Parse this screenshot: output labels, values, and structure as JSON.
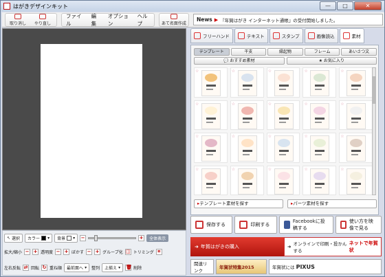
{
  "window": {
    "title": "はがきデザインキット",
    "buttons": [
      "—",
      "□",
      "✕"
    ]
  },
  "toolbar": {
    "undo_label": "取り消し",
    "redo_label": "やり直し",
    "menu": [
      "ファイル",
      "編集",
      "オプション",
      "ヘルプ"
    ],
    "address_label": "あて名面作成"
  },
  "news": {
    "label": "News",
    "text": "『年賀はがき インターネット通帳』の受付開始しました。"
  },
  "right_tabs": [
    {
      "label": "フリーハンド",
      "icon": "pen-icon"
    },
    {
      "label": "テキスト",
      "icon": "text-icon"
    },
    {
      "label": "スタンプ",
      "icon": "stamp-icon"
    },
    {
      "label": "画像読込",
      "icon": "image-icon"
    },
    {
      "label": "素材",
      "icon": "shapes-icon"
    }
  ],
  "material_tabs": [
    "テンプレート",
    "干支",
    "縁起物",
    "フレーム",
    "あいさつ文"
  ],
  "material_tabs2": [
    "おすすめ素材",
    "お気に入り"
  ],
  "templates": [
    {
      "c": "#f2c27a"
    },
    {
      "c": "#d9e3ef"
    },
    {
      "c": "#fbe2d4"
    },
    {
      "c": "#dbe8d4"
    },
    {
      "c": "#f5d5c0"
    },
    {
      "c": "#fff2d6"
    },
    {
      "c": "#f0b7b0"
    },
    {
      "c": "#f9e6b5"
    },
    {
      "c": "#f4d6e4"
    },
    {
      "c": "#f1f1f1"
    },
    {
      "c": "#e4b8c7"
    },
    {
      "c": "#ffe3c6"
    },
    {
      "c": "#d8e4f0"
    },
    {
      "c": "#e9f0d8"
    },
    {
      "c": "#e0d0c5"
    },
    {
      "c": "#f7d0c8"
    },
    {
      "c": "#f1d3b0"
    },
    {
      "c": "#fbe2e6"
    },
    {
      "c": "#e7dcef"
    },
    {
      "c": "#f5f0e0"
    }
  ],
  "find_buttons": [
    "テンプレート素材を探す",
    "パーツ素材を探す"
  ],
  "actions": [
    "保存する",
    "印刷する",
    "Facebookに投稿する",
    "使い方を映像で見る"
  ],
  "banner": {
    "left": "年賀はがきの購入",
    "right": "オンラインで印刷・投かんする",
    "right_brand": "ネットで年賀状"
  },
  "footer": {
    "link": "関連リンク",
    "special": "年賀状特集2015",
    "pixus_prefix": "年賀状には",
    "pixus": "PIXUS"
  },
  "bottom_tools": {
    "select": "選択",
    "color": "カラー",
    "bg": "背景",
    "zoom_all": "全体表示",
    "scale": "拡大/縮小",
    "transparency": "透明度",
    "blur": "ぼかす",
    "group": "グループ化",
    "trim": "トリミング",
    "flip": "左右反転",
    "rotate": "回転",
    "order": "重ね順",
    "front": "最前面へ",
    "align": "整列",
    "align_value": "上揃え",
    "delete": "削除"
  },
  "colors": {
    "accent": "#c62a1f",
    "bg": "#d6dbe9",
    "canvas": "#4a4a4a"
  }
}
